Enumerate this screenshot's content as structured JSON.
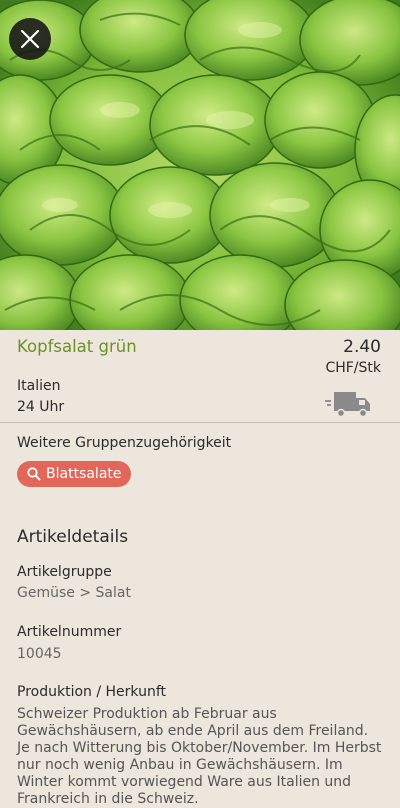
{
  "product": {
    "name": "Kopfsalat grün",
    "price": "2.40",
    "unit": "CHF/Stk",
    "origin": "Italien",
    "delivery": "24 Uhr"
  },
  "groups": {
    "title": "Weitere Gruppenzugehörigkeit",
    "chip_label": "Blattsalate"
  },
  "details": {
    "title": "Artikeldetails",
    "group_label": "Artikelgruppe",
    "group_value": "Gemüse > Salat",
    "number_label": "Artikelnummer",
    "number_value": "10045",
    "production_label": "Produktion / Herkunft",
    "production_text": "Schweizer Produktion ab Februar aus Gewächshäusern, ab ende April aus dem Freiland.\nJe nach Witterung bis Oktober/November. Im Herbst nur noch wenig Anbau in Gewächshäusern. Im Winter kommt vorwiegend Ware aus Italien und Frankreich in die Schweiz."
  },
  "icons": {
    "close": "close-icon",
    "truck": "delivery-truck-icon",
    "search": "search-icon"
  },
  "colors": {
    "background": "#ece6dc",
    "product_name": "#6f8f27",
    "chip": "#e2675b"
  }
}
